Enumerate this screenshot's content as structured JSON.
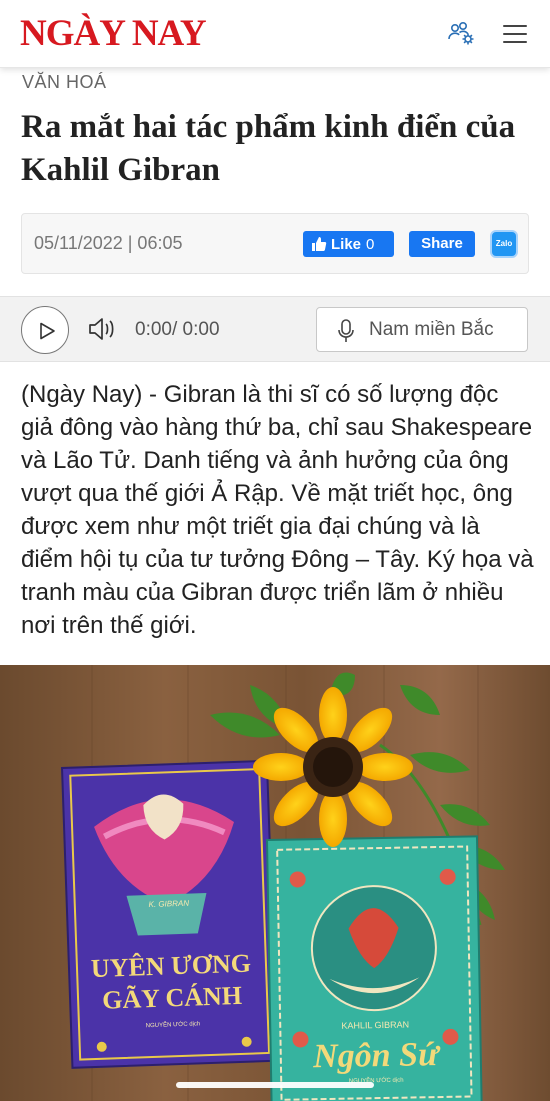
{
  "header": {
    "logo": "NGÀY NAY",
    "users_icon": "users-settings-icon",
    "menu_icon": "hamburger-menu-icon"
  },
  "article": {
    "category": "VĂN HOÁ",
    "title": "Ra mắt hai tác phẩm kinh điển của Kahlil Gibran",
    "datetime": "05/11/2022 | 06:05",
    "like_label": "Like",
    "like_count": "0",
    "share_label": "Share",
    "zalo_label": "Zalo",
    "lead": "(Ngày Nay) - Gibran là thi sĩ có số lượng độc giả đông vào hàng thứ ba, chỉ sau Shakespeare và Lão Tử. Danh tiếng và ảnh hưởng của ông vượt qua thế giới Ả Rập. Về mặt triết học, ông được xem như một triết gia đại chúng và là điểm hội tụ của tư tưởng Đông – Tây. Ký họa và tranh màu của Gibran được triển lãm ở nhiều nơi trên thế giới."
  },
  "audio": {
    "time": "0:00/ 0:00",
    "voice": "Nam miền Bắc"
  },
  "photo": {
    "book1_author": "K. GIBRAN",
    "book1_title_line1": "UYÊN ƯƠNG",
    "book1_title_line2": "GÃY CÁNH",
    "book1_translator": "NGUYỄN ƯỚC dịch",
    "book2_author": "KAHLIL GIBRAN",
    "book2_title": "Ngôn Sứ",
    "book2_translator": "NGUYỄN ƯỚC dịch"
  },
  "colors": {
    "brand": "#d71920",
    "facebook": "#1877f2",
    "zalo": "#2196f3"
  }
}
